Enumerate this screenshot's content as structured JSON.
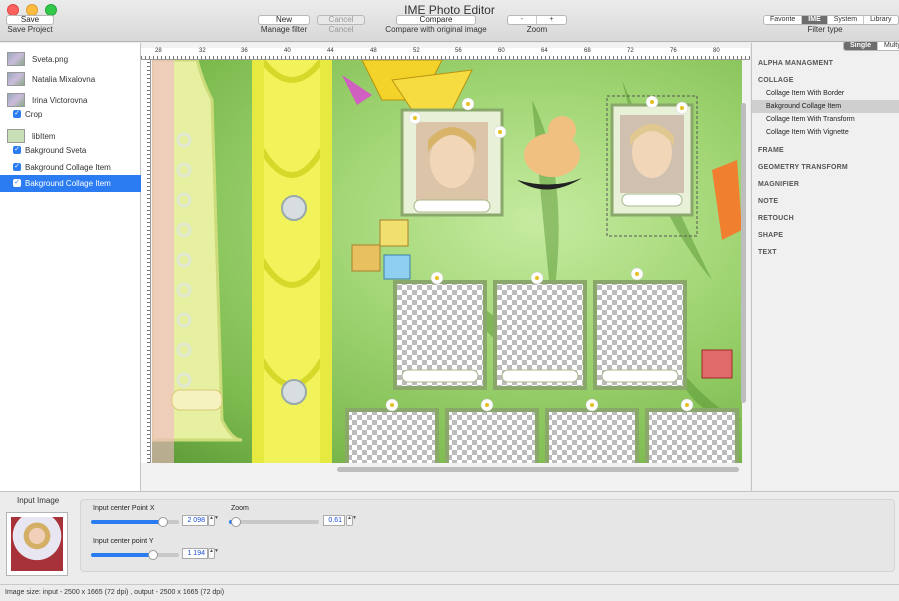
{
  "window": {
    "title": "IME Photo Editor"
  },
  "toolbar": {
    "save": {
      "label": "Save",
      "caption": "Save Project"
    },
    "new": {
      "label": "New",
      "caption": "Manage filter"
    },
    "cancel": {
      "label": "Cancel",
      "caption": "Cancel"
    },
    "compare": {
      "label": "Compare",
      "caption": "Compare with original image"
    },
    "zoom": {
      "minus": "-",
      "plus": "+",
      "caption": "Zoom"
    },
    "filter_type": {
      "options": [
        "Favorite",
        "IME",
        "System",
        "Library"
      ],
      "selected": "IME",
      "caption": "Filter type"
    }
  },
  "layers": [
    {
      "label": "Sveta.png",
      "kind": "image"
    },
    {
      "label": "Natalia Mixalovna",
      "kind": "image"
    },
    {
      "label": "Irina Victorovna",
      "kind": "image"
    },
    {
      "label": "Crop",
      "kind": "check",
      "checked": true
    },
    {
      "label": "libItem",
      "kind": "group"
    },
    {
      "label": "Bakground Sveta",
      "kind": "check",
      "checked": true
    },
    {
      "label": "Bakground Collage Item",
      "kind": "check",
      "checked": true
    },
    {
      "label": "Bakground Collage Item",
      "kind": "check",
      "checked": true,
      "selected": true
    }
  ],
  "ruler": {
    "ticks": [
      "28",
      "32",
      "36",
      "40",
      "44",
      "48",
      "52",
      "56",
      "60",
      "64",
      "68",
      "72",
      "76",
      "80"
    ]
  },
  "filters": {
    "mode": {
      "options": [
        "Single",
        "Multy"
      ],
      "selected": "Single"
    },
    "categories": [
      {
        "label": "ALPHA MANAGMENT",
        "items": []
      },
      {
        "label": "COLLAGE",
        "items": [
          "Collage Item With Border",
          "Bakground Collage Item",
          "Collage Item With Transform",
          "Collage Item With Vignette"
        ]
      },
      {
        "label": "FRAME",
        "items": []
      },
      {
        "label": "GEOMETRY TRANSFORM",
        "items": []
      },
      {
        "label": "MAGNIFIER",
        "items": []
      },
      {
        "label": "NOTE",
        "items": []
      },
      {
        "label": "RETOUCH",
        "items": []
      },
      {
        "label": "SHAPE",
        "items": []
      },
      {
        "label": "TEXT",
        "items": []
      }
    ],
    "selected_item": "Bakground Collage Item"
  },
  "input_panel": {
    "title": "Input Image",
    "params": {
      "center_x": {
        "label": "Input center Point X",
        "value": "2 098",
        "fraction": 0.82
      },
      "center_y": {
        "label": "Input center point Y",
        "value": "1 194",
        "fraction": 0.7
      },
      "zoom": {
        "label": "Zoom",
        "value": "0.61",
        "fraction": 0.08
      }
    }
  },
  "status": {
    "text": "Image size: input - 2500 x 1665 (72 dpi) , output - 2500 x 1665 (72 dpi)"
  },
  "colors": {
    "accent": "#2b7cf3",
    "canvas_green": "#9fd472"
  }
}
